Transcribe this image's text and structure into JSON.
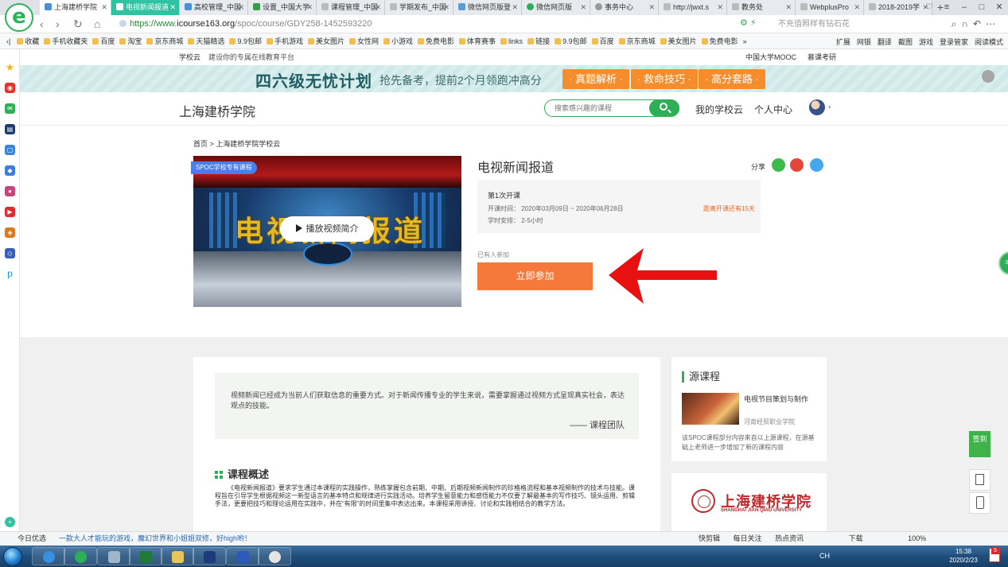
{
  "browser": {
    "tabs": [
      {
        "label": "上海建桥学院",
        "active": false
      },
      {
        "label": "电视新闻报道",
        "active": true
      },
      {
        "label": "高校管理_中国",
        "active": false
      },
      {
        "label": "设置_中国大学",
        "active": false
      },
      {
        "label": "课程管理_中国",
        "active": false
      },
      {
        "label": "学期发布_中国",
        "active": false
      },
      {
        "label": "微信网页版登",
        "active": false
      },
      {
        "label": "微信网页版",
        "active": false
      },
      {
        "label": "事务中心",
        "active": false
      },
      {
        "label": "http://jwxt.s",
        "active": false
      },
      {
        "label": "教务处",
        "active": false
      },
      {
        "label": "WebplusPro",
        "active": false
      },
      {
        "label": "2018-2019学",
        "active": false
      }
    ],
    "new_tab": "+",
    "url_prefix": "https://www.",
    "url_domain": "icourse163.org",
    "url_path": "/spoc/course/GDY258-1452593220",
    "addr_hint": "不充值照样有钻石花",
    "bookmarks": [
      "收藏",
      "手机收藏夹",
      "百度",
      "淘宝",
      "京东商城",
      "天猫精选",
      "9.9包邮",
      "手机游戏",
      "美女图片",
      "女性网",
      "小游戏",
      "免费电影",
      "体育赛事",
      "links",
      "链接",
      "9.9包邮",
      "百度",
      "京东商城",
      "美女图片",
      "免费电影"
    ],
    "bm_more": "»",
    "bm_right": [
      "扩展",
      "网银",
      "翻译",
      "截图",
      "游戏",
      "登录管家",
      "阅读模式"
    ],
    "status": {
      "today": "今日优选",
      "ad": "一款大人才能玩的游戏，魔幻世界和小姐姐双修，好high哟！",
      "right": [
        "快剪辑",
        "每日关注",
        "热点资讯",
        "下载",
        "100%"
      ]
    }
  },
  "site": {
    "topbar_brand": "学校云",
    "topbar_slogan": "建设你的专属在线教育平台",
    "topbar_right": [
      "中国大学MOOC",
      "慕课考研"
    ],
    "banner": {
      "title": "四六级无忧计划",
      "subtitle": "抢先备考，提前2个月领跑冲高分",
      "buttons": [
        "· 真题解析 ·",
        "· 救命技巧 ·",
        "· 高分套路 ·"
      ]
    },
    "school_name": "上海建桥学院",
    "search_placeholder": "搜索感兴趣的课程",
    "nav": [
      "我的学校云",
      "个人中心"
    ],
    "avatar_caret": "▾"
  },
  "course": {
    "breadcrumb": "首页 > 上海建桥学院学校云",
    "badge": "SPOC学校专有课程",
    "cover_text": "电视新闻报道",
    "play_label": "播放视频简介",
    "title": "电视新闻报道",
    "share_label": "分享",
    "session": "第1次开课",
    "dates": "开课时间： 2020年03月09日 ~ 2020年06月28日",
    "hours": "学时安排： 2-5小时",
    "countdown": "距离开课还有15天",
    "enrolled": "已有人参加",
    "join_label": "立即参加"
  },
  "intro": {
    "quote": "视频新闻已经成为当前人们获取信息的重要方式。对于新闻传播专业的学生来说，需要掌握通过视频方式呈现真实社会，表达观点的技能。",
    "signature": "—— 课程团队",
    "overview_title": "课程概述",
    "overview_text": "《电视新闻报道》要求学生通过本课程的实践操作，熟练掌握包含前期、中期、后期视频新闻制作的珍格格流程和基本视频制作的技术与技能。课程旨在引导学生根据视频这一新型语言的基本特点和规律进行实践活动。培养学生留意能力和感悟能力不仅要了解最基本的写作技巧、镜头运用、剪辑手法，更要把技巧和理论运用在实践中，并在“有限”的时间里集中表达出来。本课程采用讲授、讨论和实践相结合的教学方法。"
  },
  "source": {
    "heading": "源课程",
    "course_name": "电视节目策划与制作",
    "school": "河南经贸职业学院",
    "note": "该SPOC课程部分内容来自以上源课程，在源基础上老师进一步增加了新的课程内容"
  },
  "school_logo": {
    "cn": "上海建桥学院",
    "en": "SHANGHAI JIAN QIAO UNIVERSITY"
  },
  "side_tools": {
    "checkin": "签到",
    "float_badge": "32"
  },
  "taskbar": {
    "tray": "CH",
    "time": "15:38",
    "date": "2020/2/23",
    "notif": "5"
  },
  "colors": {
    "brand_green": "#2fae58",
    "join_orange": "#f5793b",
    "banner_orange": "#f58d2c",
    "countdown": "#f0641e",
    "arrow_red": "#e81010"
  }
}
